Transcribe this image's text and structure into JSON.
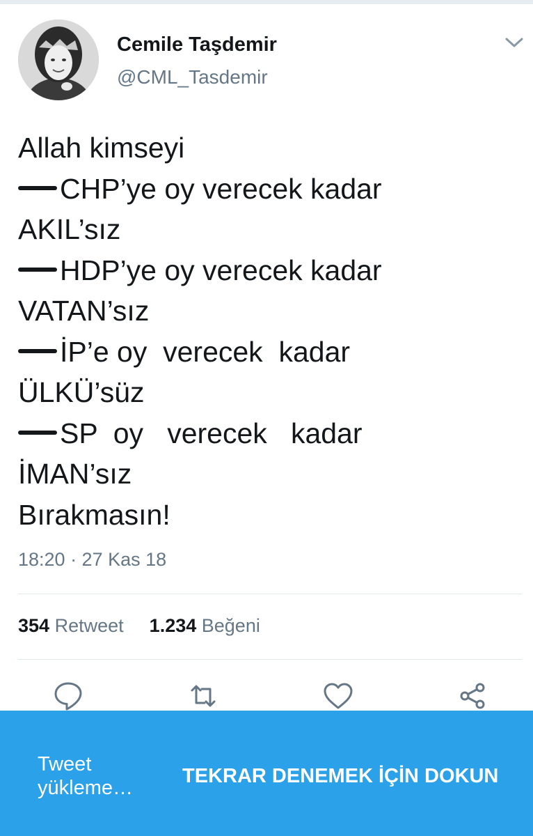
{
  "user": {
    "name": "Cemile Taşdemir",
    "handle": "@CML_Tasdemir"
  },
  "tweet": {
    "lines": [
      {
        "dash": false,
        "text": "Allah kimseyi"
      },
      {
        "dash": true,
        "text": "CHP’ye oy verecek kadar"
      },
      {
        "dash": false,
        "text": "AKIL’sız"
      },
      {
        "dash": true,
        "text": "HDP’ye oy verecek kadar"
      },
      {
        "dash": false,
        "text": "VATAN’sız"
      },
      {
        "dash": true,
        "text": "İP’e oy  verecek  kadar"
      },
      {
        "dash": false,
        "text": "ÜLKÜ’süz"
      },
      {
        "dash": true,
        "text": "SP  oy   verecek   kadar"
      },
      {
        "dash": false,
        "text": "İMAN’sız"
      },
      {
        "dash": false,
        "text": "Bırakmasın!"
      }
    ],
    "timestamp": "18:20 · 27 Kas 18"
  },
  "stats": {
    "retweet_count": "354",
    "retweet_label": "Retweet",
    "like_count": "1.234",
    "like_label": "Beğeni"
  },
  "actions": {
    "icons": [
      "reply-icon",
      "retweet-icon",
      "like-icon",
      "share-icon"
    ],
    "icon_color": "#657786"
  },
  "banner": {
    "loading_text": "Tweet yükleme…",
    "retry_text": "TEKRAR DENEMEK İÇİN DOKUN",
    "background": "#2aa1e9"
  }
}
